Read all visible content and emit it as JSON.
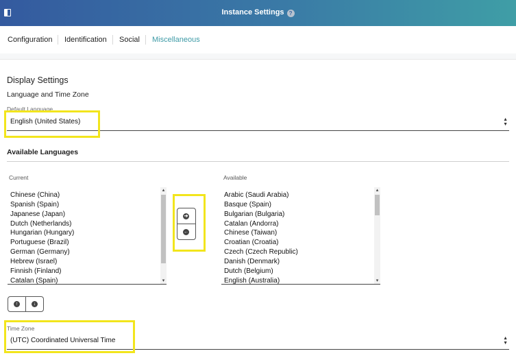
{
  "header": {
    "title": "Instance Settings",
    "help_icon": "?"
  },
  "tabs": [
    {
      "label": "Configuration"
    },
    {
      "label": "Identification"
    },
    {
      "label": "Social"
    },
    {
      "label": "Miscellaneous"
    }
  ],
  "display": {
    "heading": "Display Settings",
    "subheading": "Language and Time Zone",
    "default_language": {
      "label": "Default Language",
      "value": "English (United States)"
    },
    "available_heading": "Available Languages",
    "current": {
      "label": "Current",
      "items": [
        "Chinese (China)",
        "Spanish (Spain)",
        "Japanese (Japan)",
        "Dutch (Netherlands)",
        "Hungarian (Hungary)",
        "Portuguese (Brazil)",
        "German (Germany)",
        "Hebrew (Israel)",
        "Finnish (Finland)",
        "Catalan (Spain)"
      ]
    },
    "available": {
      "label": "Available",
      "items": [
        "Arabic (Saudi Arabia)",
        "Basque (Spain)",
        "Bulgarian (Bulgaria)",
        "Catalan (Andorra)",
        "Chinese (Taiwan)",
        "Croatian (Croatia)",
        "Czech (Czech Republic)",
        "Danish (Denmark)",
        "Dutch (Belgium)",
        "English (Australia)"
      ]
    },
    "time_zone": {
      "label": "Time Zone",
      "value": "(UTC) Coordinated Universal Time"
    }
  },
  "icons": {
    "arrow_right": "➔",
    "arrow_left": "←",
    "arrow_up": "↑",
    "arrow_down": "↓",
    "select_arrows": "▲▼",
    "scroll_up": "▴",
    "scroll_down": "▾"
  },
  "colors": {
    "header_start": "#345a9f",
    "header_end": "#3f9ea6",
    "active_tab": "#3d9aa6",
    "highlight": "#f2e51c"
  }
}
